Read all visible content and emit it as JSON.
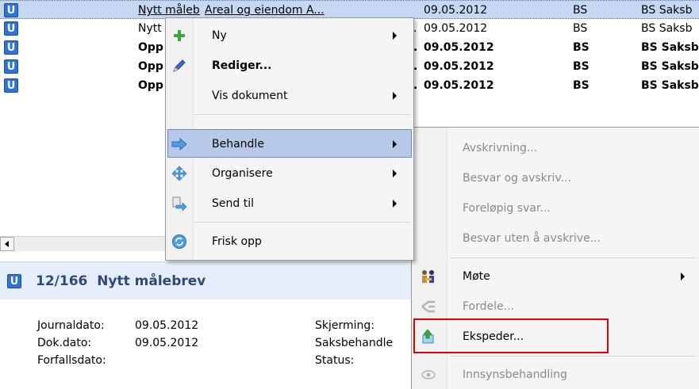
{
  "list": {
    "rows": [
      {
        "badge": "U",
        "title": "Nytt målebrev",
        "title2": "Areal og eiendom A...",
        "date": "09.05.2012",
        "code": "BS",
        "category": "BS Saksb",
        "bold": false,
        "selected": true
      },
      {
        "badge": "U",
        "title": "Nytt",
        "dash": ".",
        "date": "09.05.2012",
        "code": "BS",
        "category": "BS Saksb",
        "bold": false,
        "selected": false
      },
      {
        "badge": "U",
        "title": "Opp",
        "dash": ".",
        "date": "09.05.2012",
        "code": "BS",
        "category": "BS Saksbe",
        "bold": true,
        "selected": false
      },
      {
        "badge": "U",
        "title": "Opp",
        "dash": ".",
        "date": "09.05.2012",
        "code": "BS",
        "category": "BS Saksbe",
        "bold": true,
        "selected": false
      },
      {
        "badge": "U",
        "title": "Opp",
        "dash": ".",
        "date": "09.05.2012",
        "code": "BS",
        "category": "BS Saksbe",
        "bold": true,
        "selected": false
      }
    ]
  },
  "detail": {
    "badge": "U",
    "title": "12/166  Nytt målebrev",
    "fields": [
      {
        "label": "Journaldato:",
        "value": "09.05.2012"
      },
      {
        "label": "Dok.dato:",
        "value": "09.05.2012"
      },
      {
        "label": "Forfallsdato:",
        "value": ""
      }
    ],
    "right_fields": [
      {
        "label": "Skjerming:"
      },
      {
        "label": "Saksbehandle"
      },
      {
        "label": "Status:"
      }
    ]
  },
  "context_menu": {
    "items": [
      {
        "label": "Ny",
        "icon": "plus-icon",
        "submenu": true
      },
      {
        "label": "Rediger...",
        "icon": "pencil-icon",
        "submenu": false,
        "bold": true
      },
      {
        "label": "Vis dokument",
        "icon": "",
        "submenu": true
      },
      {
        "label": "Behandle",
        "icon": "process-arrow-icon",
        "submenu": true,
        "highlighted": true
      },
      {
        "label": "Organisere",
        "icon": "organize-icon",
        "submenu": true
      },
      {
        "label": "Send til",
        "icon": "send-to-icon",
        "submenu": true
      },
      {
        "label": "Frisk opp",
        "icon": "refresh-icon",
        "submenu": false
      }
    ]
  },
  "submenu": {
    "items": [
      {
        "label": "Avskrivning...",
        "enabled": false
      },
      {
        "label": "Besvar og avskriv...",
        "enabled": false
      },
      {
        "label": "Foreløpig svar...",
        "enabled": false
      },
      {
        "label": "Besvar uten å avskrive...",
        "enabled": false
      },
      {
        "label": "Møte",
        "enabled": true,
        "submenu": true,
        "icon": "meeting-icon"
      },
      {
        "label": "Fordele...",
        "enabled": false,
        "icon": "distribute-icon"
      },
      {
        "label": "Ekspeder...",
        "enabled": true,
        "icon": "dispatch-icon",
        "highlighted_box": true
      },
      {
        "label": "Innsynsbehandling",
        "enabled": false,
        "icon": "eye-icon"
      }
    ]
  },
  "colors": {
    "badge": "#2f73d9",
    "menu_highlight": "#b7c9e8",
    "highlight_box": "#e60000"
  }
}
